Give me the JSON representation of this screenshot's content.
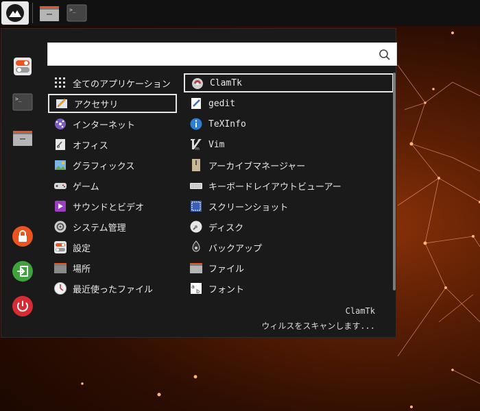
{
  "search": {
    "value": "",
    "placeholder": ""
  },
  "categories": [
    {
      "label": "全てのアプリケーション",
      "icon": "grid-icon"
    },
    {
      "label": "アクセサリ",
      "icon": "accessories-icon",
      "selected": true
    },
    {
      "label": "インターネット",
      "icon": "internet-icon"
    },
    {
      "label": "オフィス",
      "icon": "office-icon"
    },
    {
      "label": "グラフィックス",
      "icon": "graphics-icon"
    },
    {
      "label": "ゲーム",
      "icon": "games-icon"
    },
    {
      "label": "サウンドとビデオ",
      "icon": "multimedia-icon"
    },
    {
      "label": "システム管理",
      "icon": "system-icon"
    },
    {
      "label": "設定",
      "icon": "settings-icon"
    },
    {
      "label": "場所",
      "icon": "places-folder-icon"
    },
    {
      "label": "最近使ったファイル",
      "icon": "recent-files-icon"
    }
  ],
  "apps": [
    {
      "label": "ClamTk",
      "icon": "clamtk-icon",
      "selected": true
    },
    {
      "label": "gedit",
      "icon": "gedit-icon"
    },
    {
      "label": "TeXInfo",
      "icon": "texinfo-icon"
    },
    {
      "label": "Vim",
      "icon": "vim-icon"
    },
    {
      "label": "アーカイブマネージャー",
      "icon": "archive-manager-icon"
    },
    {
      "label": "キーボードレイアウトビューアー",
      "icon": "keyboard-icon"
    },
    {
      "label": "スクリーンショット",
      "icon": "screenshot-icon"
    },
    {
      "label": "ディスク",
      "icon": "disks-icon"
    },
    {
      "label": "バックアップ",
      "icon": "backup-icon"
    },
    {
      "label": "ファイル",
      "icon": "files-icon"
    },
    {
      "label": "フォント",
      "icon": "fonts-icon"
    }
  ],
  "footer": {
    "title": "ClamTk",
    "description": "ウィルスをスキャンします..."
  },
  "colors": {
    "accent": "#e95420",
    "menu_bg": "#1a1a1a",
    "logout": "#3fa33b",
    "power": "#d62c35"
  }
}
